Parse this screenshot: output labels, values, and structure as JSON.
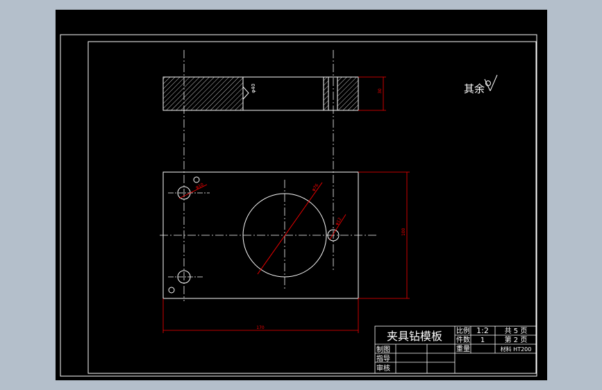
{
  "colors": {
    "background": "#b4bfcb",
    "canvas": "#000000",
    "line": "#ffffff",
    "dimension": "#ff0000"
  },
  "roughness_note": "其余",
  "top_view_dim_symbol": "φ",
  "top_view_dim_value": "40",
  "thickness_dim": "30",
  "hole_small_dim": "φ10",
  "big_hole_dim": "φ76",
  "right_hole_dim": "φ12",
  "height_dim": "100",
  "width_dim": "170",
  "title_block": {
    "part_name": "夹具钻模板",
    "scale_label": "比例",
    "scale_value": "1:2",
    "count_label": "件数",
    "count_value": "1",
    "weight_label": "重量",
    "total_sheets": "共 5 页",
    "sheet_number": "第 2 页",
    "material": "材料 HT200",
    "drawn_by": "制图",
    "guided_by": "指导",
    "reviewed_by": "审核"
  }
}
